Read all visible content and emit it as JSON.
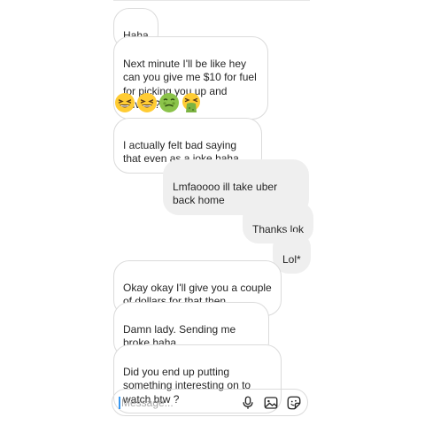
{
  "messages": [
    {
      "side": "in",
      "text": "Haha"
    },
    {
      "side": "in",
      "text": "Next minute I'll be like hey can you give me $10 for fuel for picking you up and driving?"
    },
    {
      "side": "in",
      "emojis": [
        "grinning-squinting-face-icon",
        "grinning-squinting-face-icon",
        "nauseated-face-icon",
        "vomiting-face-icon"
      ]
    },
    {
      "side": "in",
      "text": "I actually felt bad saying that even as a joke haha"
    },
    {
      "side": "out",
      "text": "Lmfaoooo ill take uber back home"
    },
    {
      "side": "out",
      "text": "Thanks lok"
    },
    {
      "side": "out",
      "text": "Lol*"
    },
    {
      "side": "in",
      "text": "Okay okay I'll give you a couple of dollars for that then"
    },
    {
      "side": "in",
      "text": "Damn lady.  Sending me broke haha"
    },
    {
      "side": "in",
      "text": "Did you end up putting something interesting on to watch btw ?"
    }
  ],
  "composer": {
    "placeholder": "Message...",
    "icons": [
      "microphone-icon",
      "gallery-icon",
      "sticker-icon"
    ]
  },
  "colors": {
    "incoming_border": "#dbdbdb",
    "outgoing_fill": "#efefef",
    "text": "#262626",
    "caret": "#3897f0"
  }
}
